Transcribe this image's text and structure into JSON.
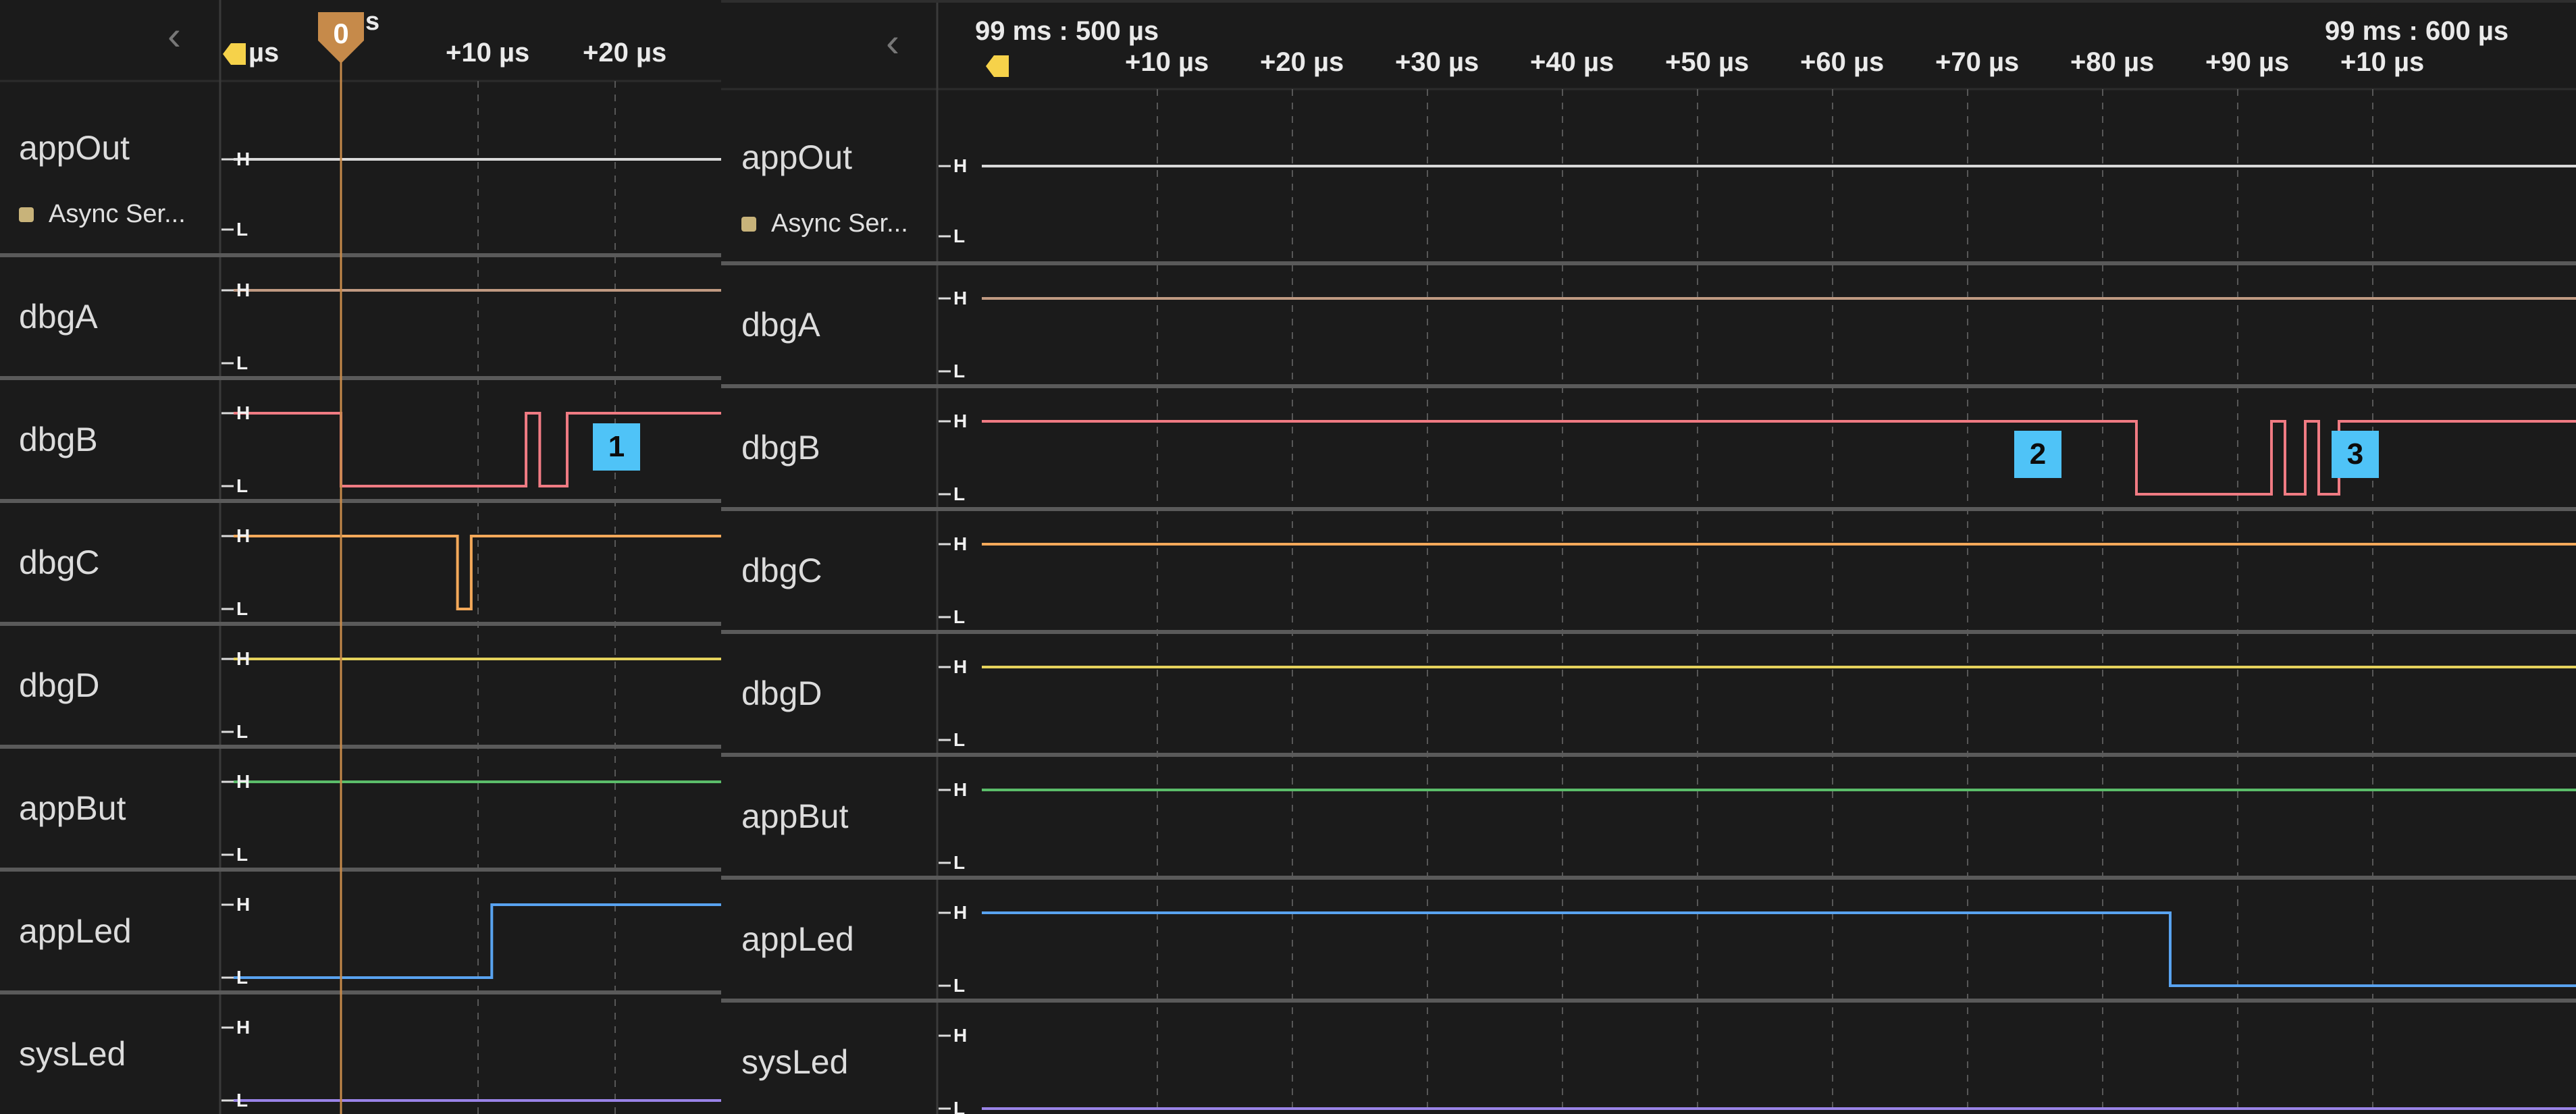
{
  "colors": {
    "appOut": "#d9d9d9",
    "dbgA": "#c09a82",
    "dbgB": "#f07b83",
    "dbgC": "#f4a95a",
    "dbgD": "#e5d25c",
    "appBut": "#5bbd6a",
    "appLed": "#59a3f0",
    "sysLed": "#9a84e8",
    "cursor": "#c68a4a",
    "marker_bg": "#4fc3f7",
    "separator": "#555555",
    "grid": "#555555"
  },
  "channels": [
    {
      "key": "appOut",
      "name": "appOut",
      "sub": "Async Ser..."
    },
    {
      "key": "dbgA",
      "name": "dbgA",
      "sub": ""
    },
    {
      "key": "dbgB",
      "name": "dbgB",
      "sub": ""
    },
    {
      "key": "dbgC",
      "name": "dbgC",
      "sub": ""
    },
    {
      "key": "dbgD",
      "name": "dbgD",
      "sub": ""
    },
    {
      "key": "appBut",
      "name": "appBut",
      "sub": ""
    },
    {
      "key": "appLed",
      "name": "appLed",
      "sub": ""
    },
    {
      "key": "sysLed",
      "name": "sysLed",
      "sub": ""
    }
  ],
  "level_high": "H",
  "level_low": "L",
  "left_panel": {
    "ticks": [
      "+10 µs",
      "+20 µs"
    ],
    "partial_label": "µs",
    "cursor_badge": "0",
    "cursor_suffix": "s",
    "marker": "1",
    "signals": {
      "appOut": [
        [
          "H",
          -9,
          28
        ]
      ],
      "dbgA": [
        [
          "H",
          -9,
          28
        ]
      ],
      "dbgB": [
        [
          "H",
          -9,
          0
        ],
        [
          "L",
          0,
          13.5
        ],
        [
          "H",
          13.5,
          14.5
        ],
        [
          "L",
          14.5,
          16.5
        ],
        [
          "H",
          16.5,
          28
        ]
      ],
      "dbgC": [
        [
          "H",
          -9,
          8.5
        ],
        [
          "L",
          8.5,
          9.5
        ],
        [
          "H",
          9.5,
          28
        ]
      ],
      "dbgD": [
        [
          "H",
          -9,
          28
        ]
      ],
      "appBut": [
        [
          "H",
          -9,
          28
        ]
      ],
      "appLed": [
        [
          "L",
          -9,
          11
        ],
        [
          "H",
          11,
          28
        ]
      ],
      "sysLed": [
        [
          "L",
          -9,
          28
        ]
      ]
    }
  },
  "right_panel": {
    "timestamp_left": "99 ms : 500 µs",
    "timestamp_right": "99 ms : 600 µs",
    "ticks": [
      "+10 µs",
      "+20 µs",
      "+30 µs",
      "+40 µs",
      "+50 µs",
      "+60 µs",
      "+70 µs",
      "+80 µs",
      "+90 µs",
      "+10 µs"
    ],
    "marker_2": "2",
    "marker_3": "3",
    "signals": {
      "appOut": [
        [
          "H",
          -3,
          117
        ]
      ],
      "dbgA": [
        [
          "H",
          -3,
          117
        ]
      ],
      "dbgB": [
        [
          "H",
          -3,
          82.5
        ],
        [
          "L",
          82.5,
          92.5
        ],
        [
          "H",
          92.5,
          93.5
        ],
        [
          "L",
          93.5,
          95
        ],
        [
          "H",
          95,
          96
        ],
        [
          "L",
          96,
          97.5
        ],
        [
          "H",
          97.5,
          117
        ]
      ],
      "dbgC": [
        [
          "H",
          -3,
          117
        ]
      ],
      "dbgD": [
        [
          "H",
          -3,
          117
        ]
      ],
      "appBut": [
        [
          "H",
          -3,
          117
        ]
      ],
      "appLed": [
        [
          "H",
          -3,
          85
        ],
        [
          "L",
          85,
          117
        ]
      ],
      "sysLed": [
        [
          "L",
          -3,
          117
        ]
      ]
    }
  }
}
